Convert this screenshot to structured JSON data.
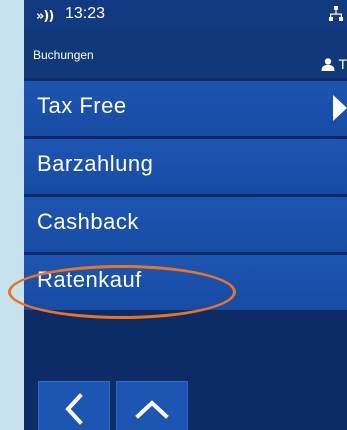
{
  "status_bar": {
    "nfc_glyph": "»))",
    "time": "13:23",
    "network_icon": "network-icon"
  },
  "header": {
    "breadcrumb": "Buchungen",
    "user_icon": "user-icon",
    "user_initial": "T"
  },
  "menu": {
    "items": [
      {
        "label": "Tax Free",
        "has_more_arrow": true
      },
      {
        "label": "Barzahlung"
      },
      {
        "label": "Cashback"
      },
      {
        "label": "Ratenkauf"
      }
    ]
  },
  "annotation": {
    "highlighted_item": "Ratenkauf",
    "color": "#e87424"
  },
  "nav": {
    "back_icon": "chevron-left-icon",
    "up_icon": "chevron-up-icon"
  },
  "colors": {
    "screen_bg": "#0d2b64",
    "menu_item_bg": "#1d55b2",
    "page_bg": "#c6e2ee"
  }
}
